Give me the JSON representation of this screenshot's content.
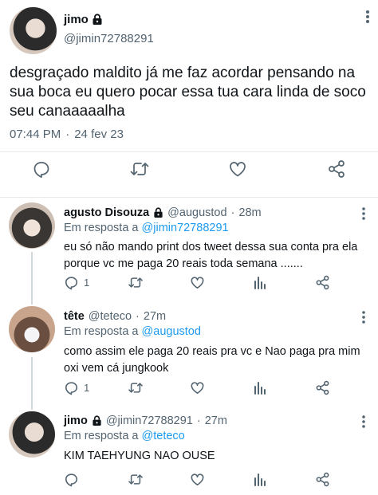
{
  "main_tweet": {
    "name": "jimo",
    "handle": "@jimin72788291",
    "text": "desgraçado maldito já me faz acordar pensando na sua boca eu quero pocar essa tua cara linda de soco seu canaaaaalha",
    "time": "07:44 PM",
    "dot": "·",
    "date": "24 fev 23",
    "icons": [
      "lock-icon",
      "more-icon",
      "reply-icon",
      "retweet-icon",
      "like-icon",
      "share-icon"
    ]
  },
  "replies": [
    {
      "name": "agusto Disouza",
      "handle": "@augustod",
      "dot": "·",
      "time": "28m",
      "replying_prefix": "Em resposta a",
      "replying_to": "@jimin72788291",
      "text": "eu só não mando print dos tweet dessa sua conta pra ela porque vc me paga 20 reais toda semana .......",
      "reply_count": "1"
    },
    {
      "name": "tête",
      "handle": "@teteco",
      "dot": "·",
      "time": "27m",
      "replying_prefix": "Em resposta a",
      "replying_to": "@augustod",
      "text": "como assim ele paga 20 reais pra vc e  Nao paga pra mim oxi vem cá jungkook",
      "reply_count": "1"
    },
    {
      "name": "jimo",
      "handle": "@jimin72788291",
      "dot": "·",
      "time": "27m",
      "replying_prefix": "Em resposta a",
      "replying_to": "@teteco",
      "text": "KIM TAEHYUNG NAO OUSE",
      "reply_count": ""
    }
  ],
  "colors": {
    "accent": "#1d9bf0",
    "muted": "#536471",
    "text": "#0f1419",
    "divider": "#e7eaec"
  }
}
